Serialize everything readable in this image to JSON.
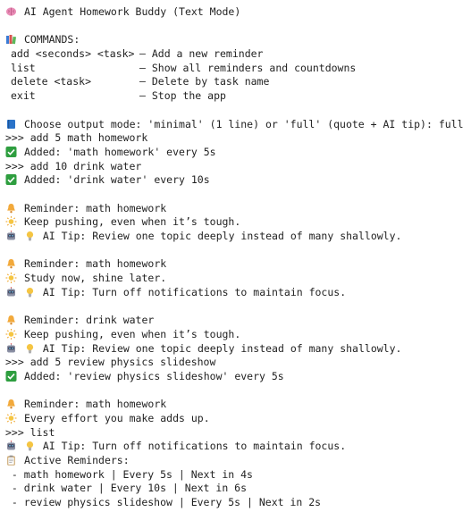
{
  "title": "AI Agent Homework Buddy (Text Mode)",
  "commands_header": "COMMANDS:",
  "commands": [
    {
      "usage": "add <seconds> <task>",
      "desc": "– Add a new reminder"
    },
    {
      "usage": "list",
      "desc": "– Show all reminders and countdowns"
    },
    {
      "usage": "delete <task>",
      "desc": "– Delete by task name"
    },
    {
      "usage": "exit",
      "desc": "– Stop the app"
    }
  ],
  "mode_prompt": "Choose output mode: 'minimal' (1 line) or 'full' (quote + AI tip): full",
  "log": {
    "l1": ">>> add 5 math homework",
    "l2": "Added: 'math homework' every 5s",
    "l3": ">>> add 10 drink water",
    "l4": "Added: 'drink water' every 10s",
    "r1_title": "Reminder: math homework",
    "r1_quote": "Keep pushing, even when it’s tough.",
    "r1_tip": "AI Tip: Review one topic deeply instead of many shallowly.",
    "r2_title": "Reminder: math homework",
    "r2_quote": "Study now, shine later.",
    "r2_tip": "AI Tip: Turn off notifications to maintain focus.",
    "r3_title": "Reminder: drink water",
    "r3_quote": "Keep pushing, even when it’s tough.",
    "r3_tip": "AI Tip: Review one topic deeply instead of many shallowly.",
    "l5": ">>> add 5 review physics slideshow",
    "l6": "Added: 'review physics slideshow' every 5s",
    "r4_title": "Reminder: math homework",
    "r4_quote": "Every effort you make adds up.",
    "r4_tip": "AI Tip: Turn off notifications to maintain focus.",
    "l7": ">>> list",
    "active_header": "Active Reminders:",
    "active": [
      " - math homework | Every 5s | Next in 4s",
      " - drink water | Every 10s | Next in 6s",
      " - review physics slideshow | Every 5s | Next in 2s"
    ]
  },
  "icons": {
    "brain": "brain-icon",
    "books": "books-icon",
    "book": "blue-book-icon",
    "check": "check-mark-icon",
    "bell": "bell-icon",
    "sun": "sun-icon",
    "robot": "robot-icon",
    "bulb": "light-bulb-icon",
    "clipboard": "clipboard-icon"
  },
  "colors": {
    "check_green": "#2e9e3f",
    "bell_orange": "#f2a93b",
    "sun_yellow": "#f5c542",
    "book_blue": "#2a73c9",
    "brain_pink": "#e88bb5"
  }
}
